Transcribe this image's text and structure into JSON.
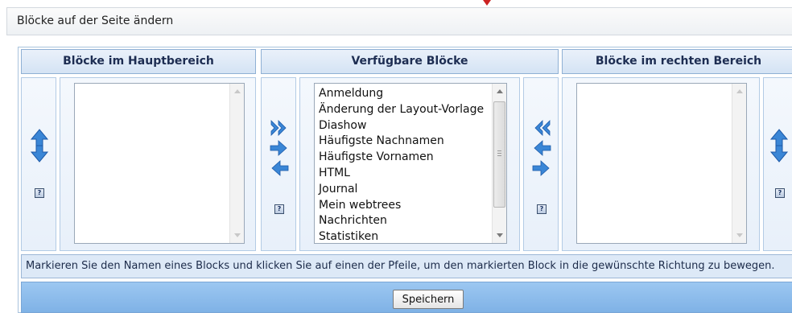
{
  "page": {
    "title": "Blöcke auf der Seite ändern"
  },
  "columns": {
    "main_header": "Blöcke im Hauptbereich",
    "available_header": "Verfügbare Blöcke",
    "right_header": "Blöcke im rechten Bereich"
  },
  "available_blocks": [
    "Anmeldung",
    "Änderung der Layout-Vorlage",
    "Diashow",
    "Häufigste Nachnamen",
    "Häufigste Vornamen",
    "HTML",
    "Journal",
    "Mein webtrees",
    "Nachrichten",
    "Statistiken"
  ],
  "help": {
    "symbol": "?"
  },
  "instructions": "Markieren Sie den Namen eines Blocks und klicken Sie auf einen der Pfeile, um den markierten Block in die gewünschte Richtung zu bewegen.",
  "footer": {
    "save_label": "Speichern"
  },
  "icons": {
    "move_up_down_main": "up-down-arrows-icon",
    "move_all_to_main": "double-arrow-right-icon",
    "move_to_main": "arrow-right-icon",
    "move_from_main": "arrow-left-icon",
    "move_all_to_right": "double-arrow-left-icon",
    "move_to_right": "arrow-left-icon",
    "move_from_right": "arrow-right-icon",
    "move_up_down_right": "up-down-arrows-icon",
    "help": "help-icon"
  },
  "colors": {
    "header_text": "#1d2d52",
    "arrow_blue": "#2f6fbe",
    "footer_bg": "#8dbdef",
    "info_bg": "#dde9f7"
  }
}
